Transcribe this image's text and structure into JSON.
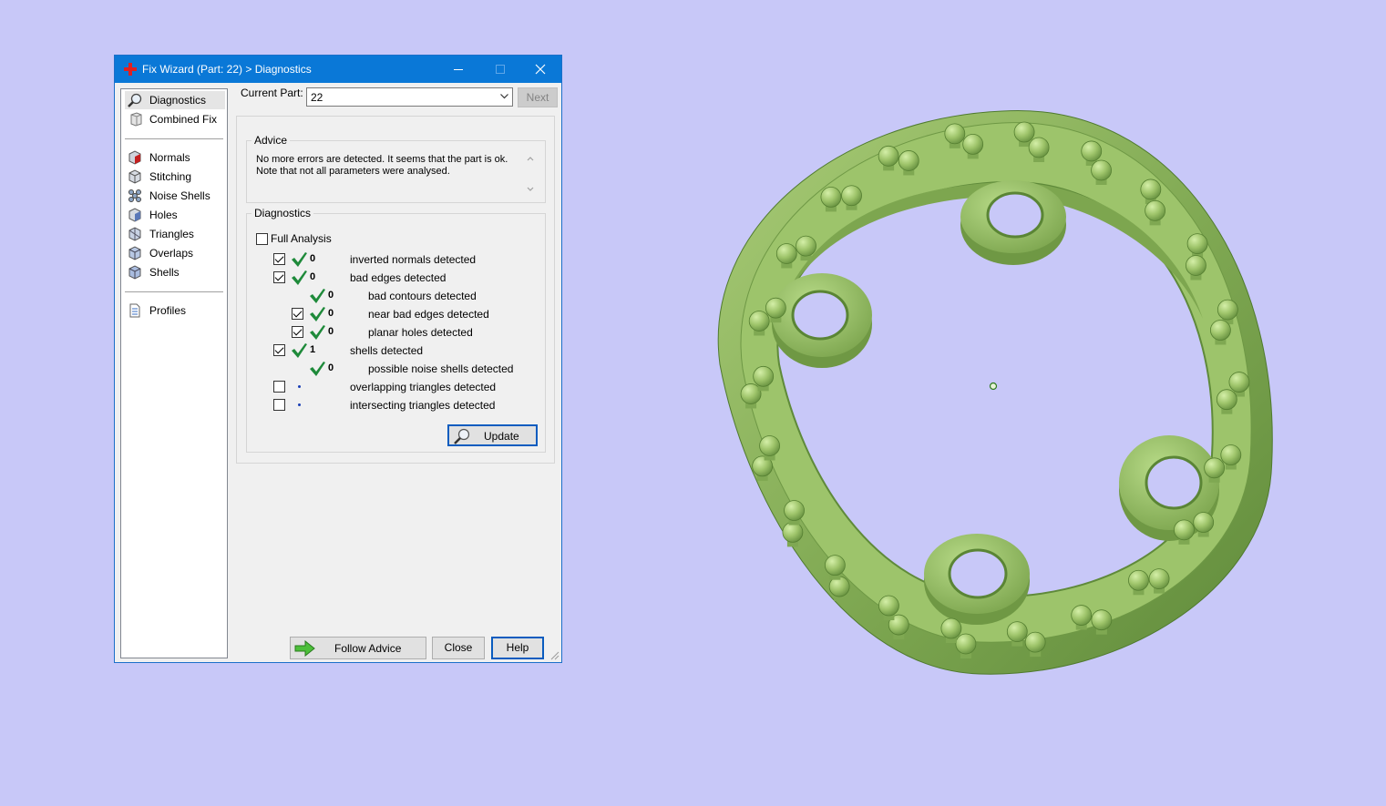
{
  "window": {
    "title": "Fix Wizard (Part: 22) > Diagnostics",
    "icons": [
      "red-cross-app-icon",
      "minimize-icon",
      "maximize-icon",
      "close-icon"
    ]
  },
  "sidebar": {
    "items": [
      {
        "label": "Diagnostics",
        "icon": "magnifier-icon",
        "selected": true
      },
      {
        "label": "Combined Fix",
        "icon": "cube-stack-icon"
      },
      {
        "label": "Normals",
        "icon": "normals-cube-icon"
      },
      {
        "label": "Stitching",
        "icon": "stitching-cube-icon"
      },
      {
        "label": "Noise Shells",
        "icon": "noise-shells-icon"
      },
      {
        "label": "Holes",
        "icon": "holes-cube-icon"
      },
      {
        "label": "Triangles",
        "icon": "triangles-cube-icon"
      },
      {
        "label": "Overlaps",
        "icon": "overlaps-cube-icon"
      },
      {
        "label": "Shells",
        "icon": "shells-cube-icon"
      },
      {
        "label": "Profiles",
        "icon": "document-icon"
      }
    ]
  },
  "current_part": {
    "label": "Current Part:",
    "value": "22",
    "next_label": "Next"
  },
  "advice": {
    "label": "Advice",
    "text": "No more errors are detected. It seems that the part is ok.\nNote that not all parameters were analysed."
  },
  "diagnostics": {
    "label": "Diagnostics",
    "full_analysis_label": "Full Analysis",
    "full_analysis_checked": false,
    "rows": [
      {
        "checkbox": true,
        "checked": true,
        "status": "ok",
        "count": "0",
        "label": "inverted normals detected",
        "indent": 0
      },
      {
        "checkbox": true,
        "checked": true,
        "status": "ok",
        "count": "0",
        "label": "bad edges detected",
        "indent": 0
      },
      {
        "checkbox": false,
        "checked": false,
        "status": "ok",
        "count": "0",
        "label": "bad contours detected",
        "indent": 1
      },
      {
        "checkbox": true,
        "checked": true,
        "status": "ok",
        "count": "0",
        "label": "near bad edges detected",
        "indent": 1
      },
      {
        "checkbox": true,
        "checked": true,
        "status": "ok",
        "count": "0",
        "label": "planar holes detected",
        "indent": 1
      },
      {
        "checkbox": true,
        "checked": true,
        "status": "ok",
        "count": "1",
        "label": "shells detected",
        "indent": 0
      },
      {
        "checkbox": false,
        "checked": false,
        "status": "ok",
        "count": "0",
        "label": "possible noise shells detected",
        "indent": 1
      },
      {
        "checkbox": true,
        "checked": false,
        "status": "pending",
        "count": "",
        "label": "overlapping triangles detected",
        "indent": 0
      },
      {
        "checkbox": true,
        "checked": false,
        "status": "pending",
        "count": "",
        "label": "intersecting triangles detected",
        "indent": 0
      }
    ],
    "update_label": "Update"
  },
  "buttons": {
    "follow_advice": "Follow Advice",
    "close": "Close",
    "help": "Help"
  },
  "colors": {
    "background": "#c8c8f8",
    "titlebar": "#0a78d7",
    "model_green": "#8fb65e",
    "check_green": "#1e8a3a"
  },
  "viewport": {
    "object": "green ring part with pin supports and four mounting tabs",
    "icons": [
      "center-marker-icon"
    ]
  }
}
